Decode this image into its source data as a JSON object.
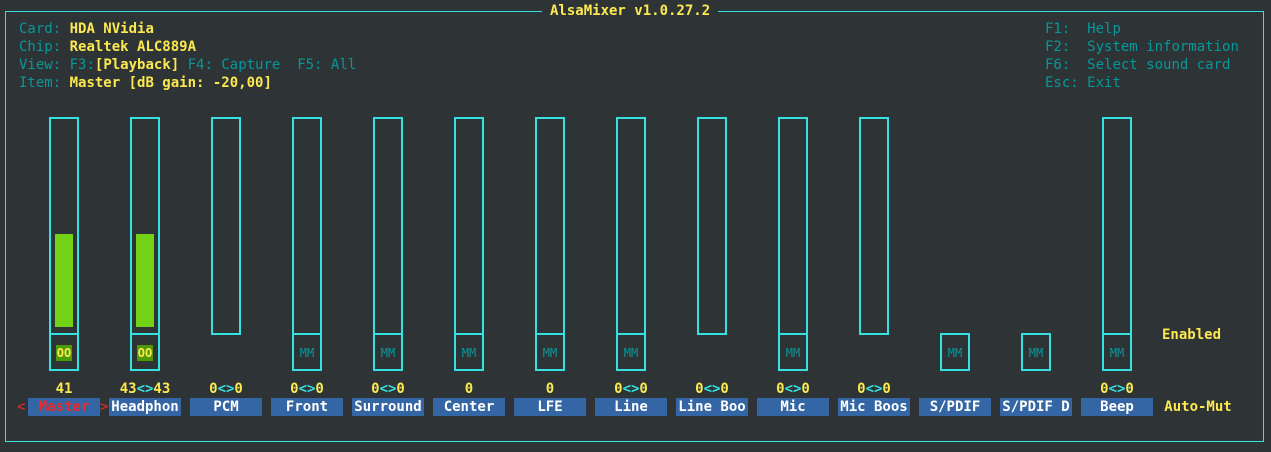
{
  "app": {
    "title": "AlsaMixer v1.0.27.2"
  },
  "info": {
    "card": {
      "label": "Card:",
      "value": "HDA NVidia"
    },
    "chip": {
      "label": "Chip:",
      "value": "Realtek ALC889A"
    },
    "view": {
      "label": "View:",
      "f3": "F3:",
      "f3_value": "[Playback]",
      "f4": "F4: Capture",
      "f5": "F5: All"
    },
    "item": {
      "label": "Item:",
      "value": "Master [dB gain: -20,00]"
    }
  },
  "help": [
    {
      "key": "F1:",
      "action": "Help"
    },
    {
      "key": "F2:",
      "action": "System information"
    },
    {
      "key": "F6:",
      "action": "Select sound card"
    },
    {
      "key": "Esc:",
      "action": "Exit"
    }
  ],
  "channels": [
    {
      "name": "Master",
      "value": "41",
      "volume": 0.5,
      "mute": "OO",
      "mute_on": true,
      "selected": true
    },
    {
      "name": "Headphon",
      "value_left": "43",
      "value_sep": "<>",
      "value_right": "43",
      "volume": 0.5,
      "mute": "OO",
      "mute_on": true
    },
    {
      "name": "PCM",
      "value_left": "0",
      "value_sep": "<>",
      "value_right": "0",
      "volume": 0
    },
    {
      "name": "Front",
      "value_left": "0",
      "value_sep": "<>",
      "value_right": "0",
      "volume": 0,
      "mute": "MM"
    },
    {
      "name": "Surround",
      "value_left": "0",
      "value_sep": "<>",
      "value_right": "0",
      "volume": 0,
      "mute": "MM"
    },
    {
      "name": "Center",
      "value": "0",
      "volume": 0,
      "mute": "MM"
    },
    {
      "name": "LFE",
      "value": "0",
      "volume": 0,
      "mute": "MM"
    },
    {
      "name": "Line",
      "value_left": "0",
      "value_sep": "<>",
      "value_right": "0",
      "volume": 0,
      "mute": "MM"
    },
    {
      "name": "Line Boo",
      "value_left": "0",
      "value_sep": "<>",
      "value_right": "0",
      "volume": 0
    },
    {
      "name": "Mic",
      "value_left": "0",
      "value_sep": "<>",
      "value_right": "0",
      "volume": 0,
      "mute": "MM"
    },
    {
      "name": "Mic Boos",
      "value_left": "0",
      "value_sep": "<>",
      "value_right": "0",
      "volume": 0
    },
    {
      "name": "S/PDIF",
      "mute": "MM"
    },
    {
      "name": "S/PDIF D",
      "mute": "MM"
    },
    {
      "name": "Beep",
      "value_left": "0",
      "value_sep": "<>",
      "value_right": "0",
      "volume": 0,
      "mute": "MM"
    },
    {
      "name": "Auto-Mut",
      "enum_value": "Enabled"
    }
  ],
  "selection": {
    "left_arrow": "<",
    "right_arrow": ">"
  },
  "colors": {
    "border": "#34e2e2",
    "fill": "#73d216",
    "label": "#06989a",
    "value": "#fce94f",
    "name_bg": "#3465a4",
    "selected": "#ef2929"
  }
}
